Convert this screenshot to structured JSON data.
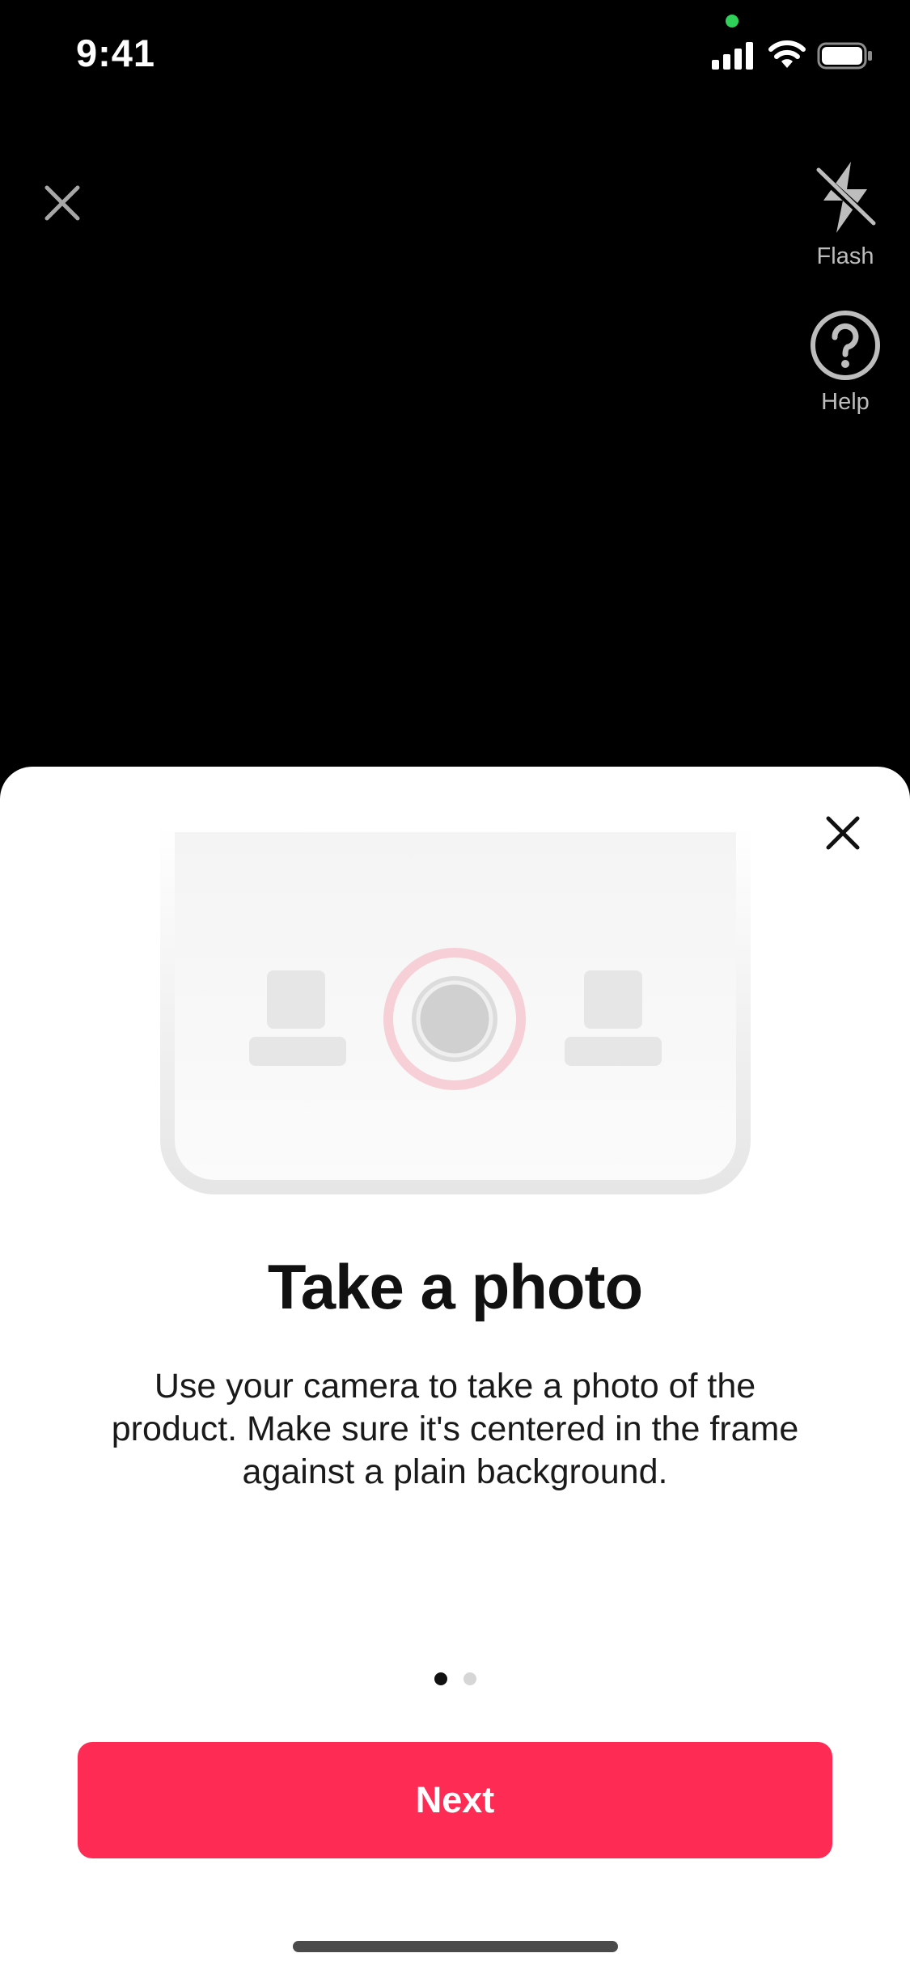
{
  "status_bar": {
    "time": "9:41",
    "icons": [
      "cellular-signal-icon",
      "wifi-icon",
      "battery-icon"
    ],
    "privacy_indicator_color": "#30d158"
  },
  "camera": {
    "close_icon": "close-icon",
    "tools": [
      {
        "label": "Flash",
        "icon": "flash-off-icon"
      },
      {
        "label": "Help",
        "icon": "help-icon"
      }
    ]
  },
  "sheet": {
    "close_icon": "close-icon",
    "illustration_icon": "camera-shutter-illustration-icon",
    "title": "Take a photo",
    "body": "Use your camera to take a photo of the product. Make sure it's centered in the frame against a plain background.",
    "pager": {
      "total": 2,
      "current": 1
    },
    "next_button_label": "Next"
  },
  "colors": {
    "accent": "#fe2c55",
    "camera_background": "#000000",
    "sheet_background": "#ffffff"
  }
}
